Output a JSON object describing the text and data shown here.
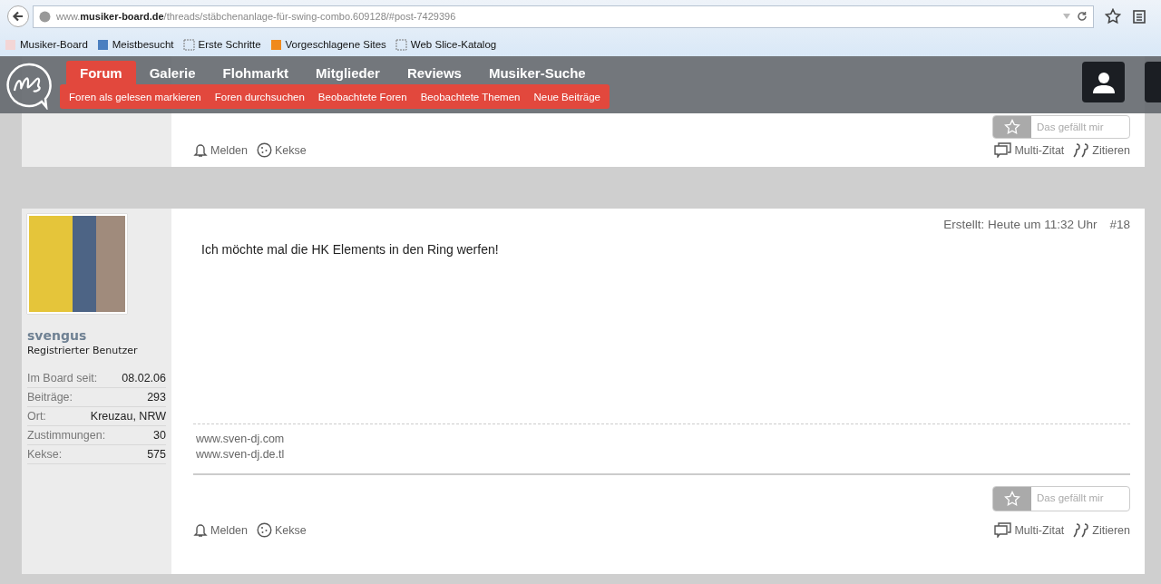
{
  "browser": {
    "url": "www.**musiker-board.de**/threads/stäbchenanlage-für-swing-combo.609128/#post-7429396",
    "bookmarks": [
      "Musiker-Board",
      "Meistbesucht",
      "Erste Schritte",
      "Vorgeschlagene Sites",
      "Web Slice-Katalog"
    ]
  },
  "nav": {
    "tabs": [
      {
        "label": "Forum",
        "selected": true
      },
      {
        "label": "Galerie",
        "selected": false
      },
      {
        "label": "Flohmarkt",
        "selected": false
      },
      {
        "label": "Mitglieder",
        "selected": false
      },
      {
        "label": "Reviews",
        "selected": false
      },
      {
        "label": "Musiker-Suche",
        "selected": false
      }
    ],
    "subnav": [
      "Foren als gelesen markieren",
      "Foren durchsuchen",
      "Beobachtete Foren",
      "Beobachtete Themen",
      "Neue Beiträge"
    ]
  },
  "posts": [
    {
      "kind": "partial",
      "like": "Das gefällt mir",
      "actions_left": [
        "Melden",
        "Kekse"
      ],
      "actions_right": [
        "Multi-Zitat",
        "Zitieren"
      ]
    },
    {
      "kind": "full",
      "author": "svengus",
      "role": "Registrierter Benutzer",
      "stats": [
        {
          "label": "Im Board seit:",
          "value": "08.02.06"
        },
        {
          "label": "Beiträge:",
          "value": "293"
        },
        {
          "label": "Ort:",
          "value": "Kreuzau, NRW"
        },
        {
          "label": "Zustimmungen:",
          "value": "30"
        },
        {
          "label": "Kekse:",
          "value": "575"
        }
      ],
      "created": "Erstellt: Heute um 11:32 Uhr",
      "number": "#18",
      "message": "Ich möchte mal die HK Elements in den Ring werfen!",
      "signature": [
        "www.sven-dj.com",
        "www.sven-dj.de.tl"
      ],
      "like": "Das gefällt mir",
      "actions_left": [
        "Melden",
        "Kekse"
      ],
      "actions_right": [
        "Multi-Zitat",
        "Zitieren"
      ]
    }
  ]
}
